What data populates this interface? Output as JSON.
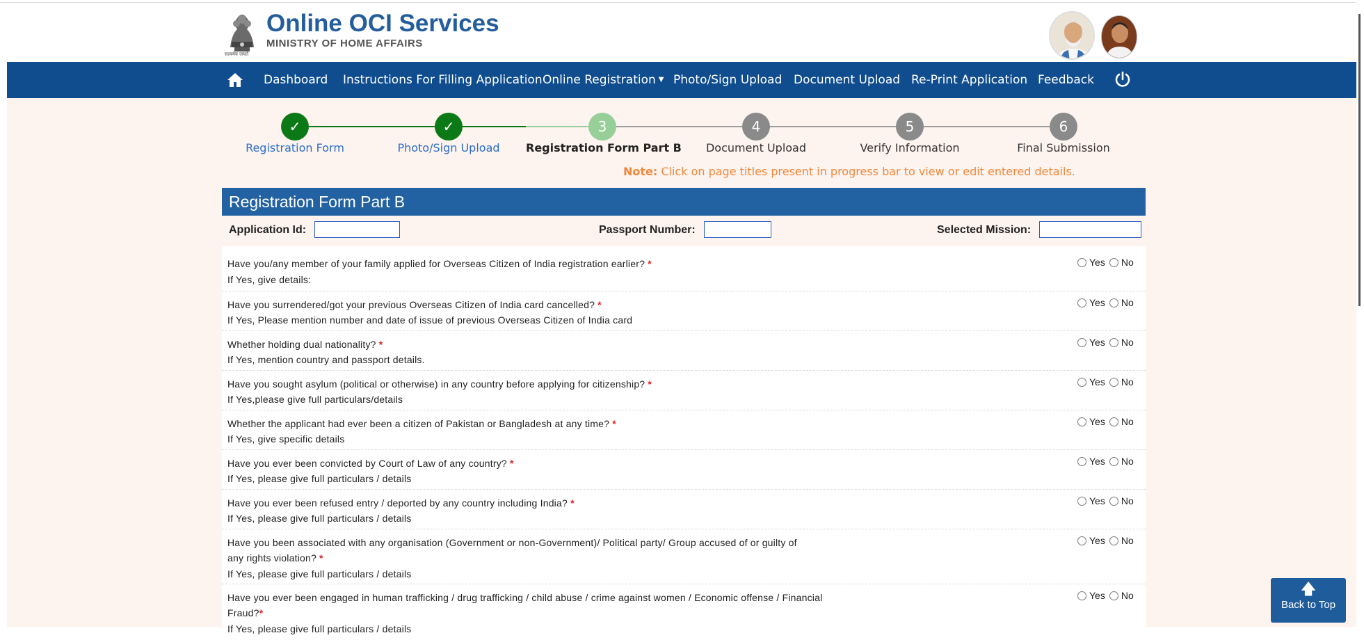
{
  "header": {
    "title": "Online OCI Services",
    "subtitle": "MINISTRY OF HOME AFFAIRS",
    "emblem_motto": "सत्यमेव जयते"
  },
  "nav": {
    "items": [
      {
        "label": "Dashboard"
      },
      {
        "label": "Instructions For Filling Application"
      },
      {
        "label": "Online Registration"
      },
      {
        "label": "Photo/Sign Upload"
      },
      {
        "label": "Document Upload"
      },
      {
        "label": "Re-Print Application"
      },
      {
        "label": "Feedback"
      }
    ]
  },
  "progress": {
    "steps": [
      {
        "number": "✓",
        "label": "Registration Form",
        "status": "done"
      },
      {
        "number": "✓",
        "label": "Photo/Sign Upload",
        "status": "done"
      },
      {
        "number": "3",
        "label": "Registration Form Part B",
        "status": "current"
      },
      {
        "number": "4",
        "label": "Document Upload",
        "status": "todo"
      },
      {
        "number": "5",
        "label": "Verify Information",
        "status": "todo"
      },
      {
        "number": "6",
        "label": "Final Submission",
        "status": "todo"
      }
    ],
    "note_prefix": "Note:",
    "note_text": " Click on page titles present in progress bar to view or edit entered details."
  },
  "form": {
    "title": "Registration Form Part B",
    "application_id_label": "Application Id:",
    "application_id_value": "",
    "passport_number_label": "Passport Number:",
    "passport_number_value": "",
    "selected_mission_label": "Selected Mission:",
    "selected_mission_value": "",
    "yes_label": "Yes",
    "no_label": "No",
    "questions": [
      {
        "text": "Have you/any member of your family applied for Overseas Citizen of India registration earlier?",
        "required": "*",
        "sub": "If Yes, give details:"
      },
      {
        "text": "Have you surrendered/got your previous Overseas Citizen of India card cancelled?",
        "required": "*",
        "sub": "If Yes, Please mention number and date of issue of previous Overseas Citizen of India card"
      },
      {
        "text": "Whether holding dual nationality?",
        "required": "*",
        "sub": "If Yes, mention country and passport details."
      },
      {
        "text": "Have you sought asylum (political or otherwise) in any country before applying for citizenship?",
        "required": "*",
        "sub": "If Yes,please give full particulars/details"
      },
      {
        "text": "Whether the applicant had ever been a citizen of Pakistan or Bangladesh at any time?",
        "required": "*",
        "sub": "If Yes, give specific details"
      },
      {
        "text": "Have you ever been convicted by Court of Law of any country?",
        "required": "*",
        "sub": "If Yes, please give full particulars / details"
      },
      {
        "text": "Have you ever been refused entry / deported by any country including India?",
        "required": "*",
        "sub": "If Yes, please give full particulars / details"
      },
      {
        "text": "Have you been associated with any organisation (Government or non-Government)/ Political party/ Group accused of or guilty of",
        "text2": "any rights violation?",
        "required": "*",
        "sub": "If Yes, please give full particulars / details"
      },
      {
        "text": "Have you ever been engaged in human trafficking / drug trafficking / child abuse / crime against women / Economic offense / Financial",
        "text2": "Fraud?",
        "required": "*",
        "sub": "If Yes, please give full particulars / details"
      }
    ]
  },
  "back_to_top": "Back to Top",
  "colors": {
    "navbar": "#0f4d8f",
    "title_bar": "#2362a2",
    "done_step": "#0b7a16",
    "current_step": "#97cf99",
    "todo_step": "#8a8a8a",
    "note": "#f0883a",
    "required": "#e02020"
  }
}
